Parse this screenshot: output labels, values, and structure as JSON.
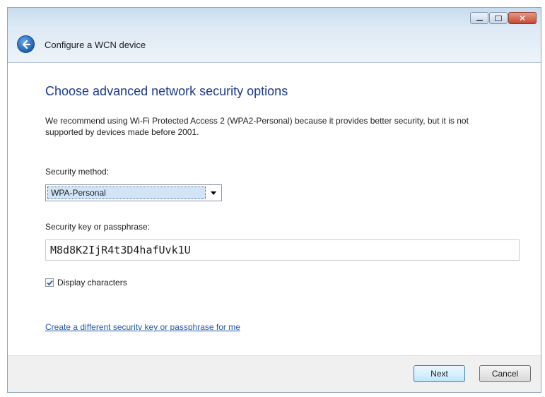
{
  "window": {
    "title": "Configure a WCN device",
    "close_glyph": "✕"
  },
  "main": {
    "heading": "Choose advanced network security options",
    "description": "We recommend using Wi-Fi Protected Access 2 (WPA2-Personal) because it provides better security,  but it is not supported by devices made before 2001.",
    "security_method_label": "Security method:",
    "security_method_value": "WPA-Personal",
    "security_key_label": "Security key or passphrase:",
    "security_key_value": "M8d8K2IjR4t3D4hafUvk1U",
    "display_characters_label": "Display characters",
    "display_characters_checked": true,
    "different_key_link": "Create a different security key or passphrase for me"
  },
  "footer": {
    "next_label": "Next",
    "cancel_label": "Cancel"
  },
  "icons": {
    "back": "back-arrow-icon",
    "minimize": "minimize-icon",
    "maximize": "maximize-icon",
    "close": "close-icon",
    "dropdown": "chevron-down-icon",
    "checkmark": "checkmark-icon"
  },
  "colors": {
    "heading": "#1c3a8a",
    "link": "#2358a6",
    "close_button": "#c54a33",
    "back_button": "#1d5fb4"
  }
}
